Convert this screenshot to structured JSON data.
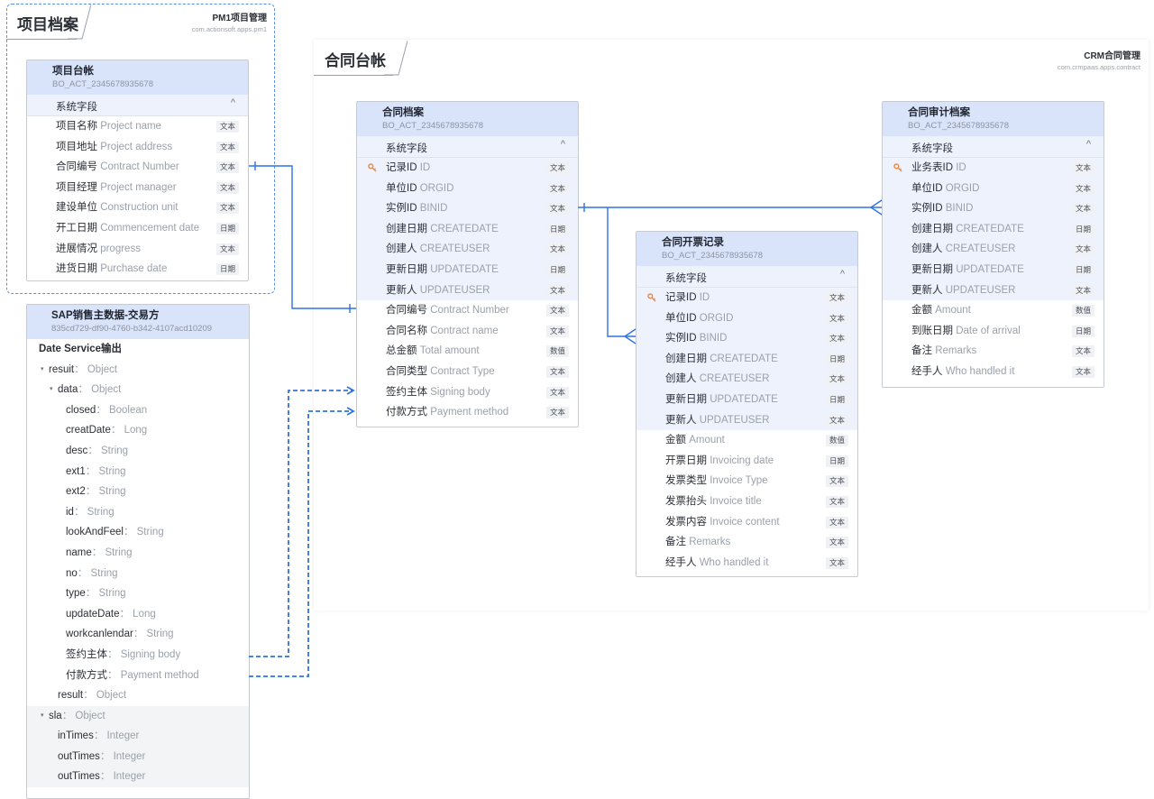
{
  "project_group": {
    "title": "项目档案",
    "app_name": "PM1项目管理",
    "app_id": "com.actionsoft.apps.pm1"
  },
  "contract_group": {
    "title": "合同台帐",
    "app_name": "CRM合同管理",
    "app_id": "com.crmpaas.apps.contract"
  },
  "tables": {
    "project_ledger": {
      "title": "项目台帐",
      "id": "BO_ACT_2345678935678",
      "section": "系统字段",
      "chevron": "^",
      "fields": [
        {
          "cn": "项目名称",
          "en": "Project name",
          "type": "文本"
        },
        {
          "cn": "项目地址",
          "en": "Project address",
          "type": "文本"
        },
        {
          "cn": "合同编号",
          "en": "Contract Number",
          "type": "文本"
        },
        {
          "cn": "项目经理",
          "en": "Project manager",
          "type": "文本"
        },
        {
          "cn": "建设单位",
          "en": "Construction unit",
          "type": "文本"
        },
        {
          "cn": "开工日期",
          "en": "Commencement date",
          "type": "日期"
        },
        {
          "cn": "进展情况",
          "en": "progress",
          "type": "文本"
        },
        {
          "cn": "进货日期",
          "en": "Purchase date",
          "type": "日期"
        }
      ]
    },
    "contract_archive": {
      "title": "合同档案",
      "id": "BO_ACT_2345678935678",
      "section": "系统字段",
      "chevron": "^",
      "system_fields": [
        {
          "cn": "记录ID",
          "en": "ID",
          "type": "文本",
          "key": true
        },
        {
          "cn": "单位ID",
          "en": "ORGID",
          "type": "文本"
        },
        {
          "cn": "实例ID",
          "en": "BINID",
          "type": "文本"
        },
        {
          "cn": "创建日期",
          "en": "CREATEDATE",
          "type": "日期"
        },
        {
          "cn": "创建人",
          "en": "CREATEUSER",
          "type": "文本"
        },
        {
          "cn": "更新日期",
          "en": "UPDATEDATE",
          "type": "日期"
        },
        {
          "cn": "更新人",
          "en": "UPDATEUSER",
          "type": "文本"
        }
      ],
      "fields": [
        {
          "cn": "合同编号",
          "en": "Contract Number",
          "type": "文本"
        },
        {
          "cn": "合同名称",
          "en": "Contract name",
          "type": "文本"
        },
        {
          "cn": "总金额",
          "en": "Total amount",
          "type": "数值"
        },
        {
          "cn": "合同类型",
          "en": "Contract Type",
          "type": "文本"
        },
        {
          "cn": "签约主体",
          "en": "Signing body",
          "type": "文本"
        },
        {
          "cn": "付款方式",
          "en": "Payment method",
          "type": "文本"
        }
      ]
    },
    "invoice_record": {
      "title": "合同开票记录",
      "id": "BO_ACT_2345678935678",
      "section": "系统字段",
      "chevron": "^",
      "system_fields": [
        {
          "cn": "记录ID",
          "en": "ID",
          "type": "文本",
          "key": true
        },
        {
          "cn": "单位ID",
          "en": "ORGID",
          "type": "文本"
        },
        {
          "cn": "实例ID",
          "en": "BINID",
          "type": "文本"
        },
        {
          "cn": "创建日期",
          "en": "CREATEDATE",
          "type": "日期"
        },
        {
          "cn": "创建人",
          "en": "CREATEUSER",
          "type": "文本"
        },
        {
          "cn": "更新日期",
          "en": "UPDATEDATE",
          "type": "日期"
        },
        {
          "cn": "更新人",
          "en": "UPDATEUSER",
          "type": "文本"
        }
      ],
      "fields": [
        {
          "cn": "金额",
          "en": "Amount",
          "type": "数值"
        },
        {
          "cn": "开票日期",
          "en": "Invoicing date",
          "type": "日期"
        },
        {
          "cn": "发票类型",
          "en": "Invoice Type",
          "type": "文本"
        },
        {
          "cn": "发票抬头",
          "en": "Invoice title",
          "type": "文本"
        },
        {
          "cn": "发票内容",
          "en": "Invoice content",
          "type": "文本"
        },
        {
          "cn": "备注",
          "en": "Remarks",
          "type": "文本"
        },
        {
          "cn": "经手人",
          "en": "Who handled it",
          "type": "文本"
        }
      ]
    },
    "audit_archive": {
      "title": "合同审计档案",
      "id": "BO_ACT_2345678935678",
      "section": "系统字段",
      "chevron": "^",
      "system_fields": [
        {
          "cn": "业务表ID",
          "en": "ID",
          "type": "文本",
          "key": true
        },
        {
          "cn": "单位ID",
          "en": "ORGID",
          "type": "文本"
        },
        {
          "cn": "实例ID",
          "en": "BINID",
          "type": "文本"
        },
        {
          "cn": "创建日期",
          "en": "CREATEDATE",
          "type": "日期"
        },
        {
          "cn": "创建人",
          "en": "CREATEUSER",
          "type": "文本"
        },
        {
          "cn": "更新日期",
          "en": "UPDATEDATE",
          "type": "日期"
        },
        {
          "cn": "更新人",
          "en": "UPDATEUSER",
          "type": "文本"
        }
      ],
      "fields": [
        {
          "cn": "金额",
          "en": "Amount",
          "type": "数值"
        },
        {
          "cn": "到账日期",
          "en": "Date of arrival",
          "type": "日期"
        },
        {
          "cn": "备注",
          "en": "Remarks",
          "type": "文本"
        },
        {
          "cn": "经手人",
          "en": "Who handled it",
          "type": "文本"
        }
      ]
    }
  },
  "sap": {
    "title": "SAP销售主数据-交易方",
    "id": "835cd729-df90-4760-b342-4107acd10209",
    "output_label": "Date Service输出",
    "tree": [
      {
        "name": "resuit",
        "type": "Object",
        "level": 0,
        "toggle": "▾"
      },
      {
        "name": "data",
        "type": "Object",
        "level": 1,
        "toggle": "▾"
      },
      {
        "name": "closed",
        "type": "Boolean",
        "level": 2
      },
      {
        "name": "creatDate",
        "type": "Long",
        "level": 2
      },
      {
        "name": "desc",
        "type": "String",
        "level": 2
      },
      {
        "name": "ext1",
        "type": "String",
        "level": 2
      },
      {
        "name": "ext2",
        "type": "String",
        "level": 2
      },
      {
        "name": "id",
        "type": "String",
        "level": 2
      },
      {
        "name": "lookAndFeel",
        "type": "String",
        "level": 2
      },
      {
        "name": "name",
        "type": "String",
        "level": 2
      },
      {
        "name": "no",
        "type": "String",
        "level": 2
      },
      {
        "name": "type",
        "type": "String",
        "level": 2
      },
      {
        "name": "updateDate",
        "type": "Long",
        "level": 2
      },
      {
        "name": "workcanlendar",
        "type": "String",
        "level": 2
      },
      {
        "name": "签约主体",
        "type": "Signing body",
        "level": 2
      },
      {
        "name": "付款方式",
        "type": "Payment method",
        "level": 2
      },
      {
        "name": "result",
        "type": "Object",
        "level": 1
      },
      {
        "name": "sla",
        "type": "Object",
        "level": 0,
        "toggle": "▾",
        "highlight": true
      },
      {
        "name": "inTimes",
        "type": "Integer",
        "level": 1,
        "highlight": true
      },
      {
        "name": "outTimes",
        "type": "Integer",
        "level": 1,
        "highlight": true
      },
      {
        "name": "outTimes",
        "type": "Integer",
        "level": 1,
        "highlight": true
      }
    ]
  },
  "colors": {
    "accent": "#2f73e0",
    "header_bg": "#d9e4fb",
    "system_bg": "#eef2fc",
    "key_icon": "#e8894a"
  }
}
